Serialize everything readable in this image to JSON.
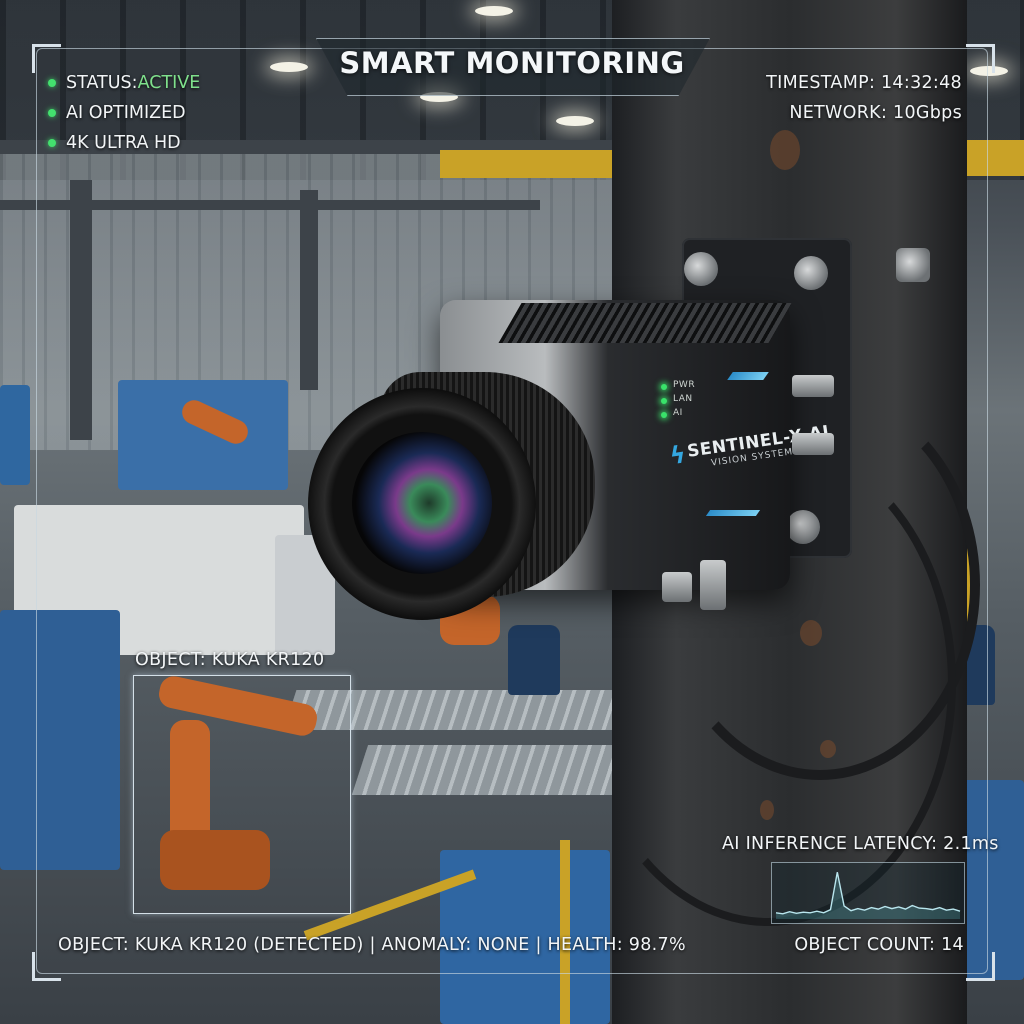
{
  "hud": {
    "title": "SMART MONITORING",
    "status_prefix": "STATUS: ",
    "status_value": "ACTIVE",
    "indicators": [
      "AI OPTIMIZED",
      "4K ULTRA HD"
    ],
    "timestamp": "TIMESTAMP: 14:32:48",
    "network": "NETWORK: 10Gbps",
    "detection_label": "OBJECT: KUKA KR120",
    "latency": "AI INFERENCE LATENCY: 2.1ms",
    "summary": "OBJECT: KUKA KR120 (DETECTED) | ANOMALY: NONE | HEALTH: 98.7%",
    "object_count": "OBJECT COUNT: 14",
    "latency_trace": [
      0.12,
      0.1,
      0.14,
      0.11,
      0.13,
      0.12,
      0.15,
      0.12,
      0.18,
      0.9,
      0.25,
      0.16,
      0.2,
      0.17,
      0.22,
      0.19,
      0.24,
      0.2,
      0.23,
      0.19,
      0.26,
      0.21,
      0.2,
      0.18,
      0.22,
      0.17,
      0.19,
      0.15
    ]
  },
  "camera": {
    "brand": "SENTINEL-X AI",
    "brand_sub": "VISION SYSTEMS",
    "led_labels": [
      "PWR",
      "LAN",
      "AI"
    ]
  },
  "colors": {
    "accent_green": "#43e06e",
    "hud_line": "#d4e0e8",
    "brand_blue": "#34a7e0"
  }
}
